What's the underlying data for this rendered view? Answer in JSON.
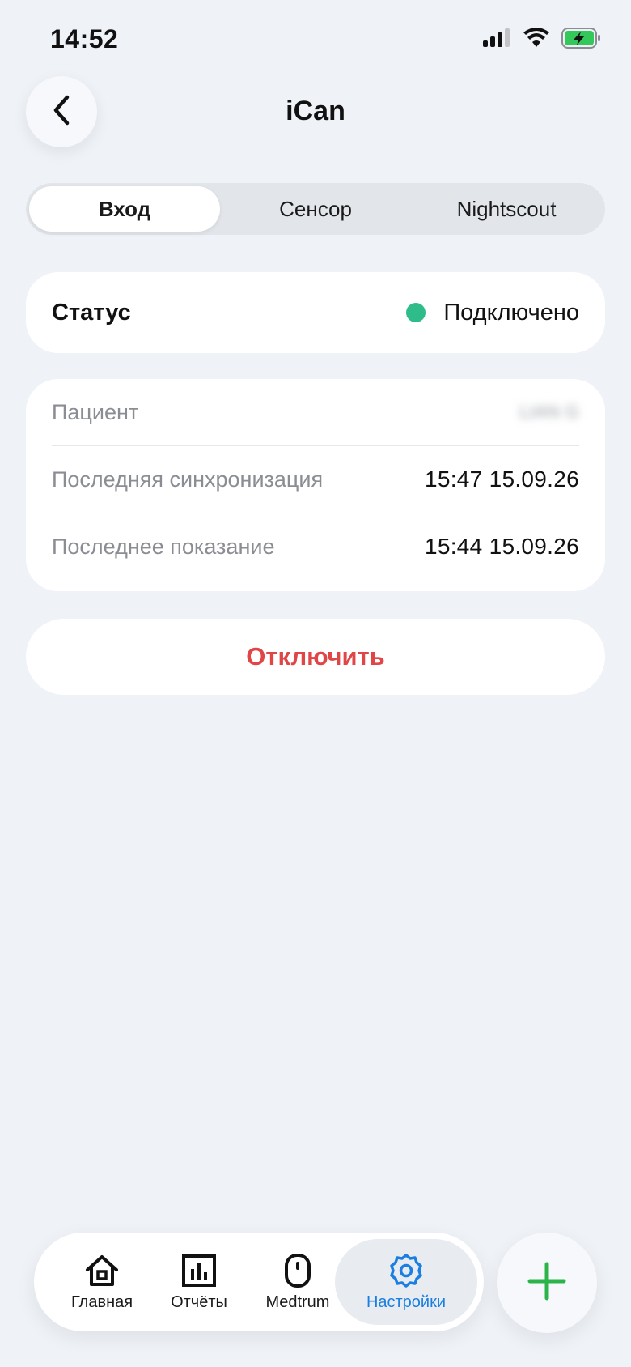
{
  "status_bar": {
    "time": "14:52",
    "icons": [
      "cellular-signal-icon",
      "wifi-icon",
      "battery-charging-icon"
    ]
  },
  "header": {
    "title": "iCan",
    "back_icon": "chevron-left-icon"
  },
  "tabs": [
    {
      "label": "Вход",
      "active": true
    },
    {
      "label": "Сенсор",
      "active": false
    },
    {
      "label": "Nightscout",
      "active": false
    }
  ],
  "status": {
    "label": "Статус",
    "value": "Подключено",
    "indicator_color": "#2ebd8a"
  },
  "info": {
    "patient_label": "Пациент",
    "patient_value": "LIAN G",
    "last_sync_label": "Последняя синхронизация",
    "last_sync_value": "15:47 15.09.26",
    "last_reading_label": "Последнее показание",
    "last_reading_value": "15:44 15.09.26"
  },
  "disconnect_label": "Отключить",
  "bottom_nav": [
    {
      "label": "Главная",
      "icon": "home-icon",
      "active": false
    },
    {
      "label": "Отчёты",
      "icon": "bar-chart-icon",
      "active": false
    },
    {
      "label": "Medtrum",
      "icon": "device-icon",
      "active": false
    },
    {
      "label": "Настройки",
      "icon": "gear-icon",
      "active": true
    }
  ],
  "colors": {
    "accent": "#1a7fe0",
    "danger": "#e04646",
    "success": "#2ebd8a",
    "fab_plus": "#2cb34a",
    "background": "#eff2f6"
  }
}
